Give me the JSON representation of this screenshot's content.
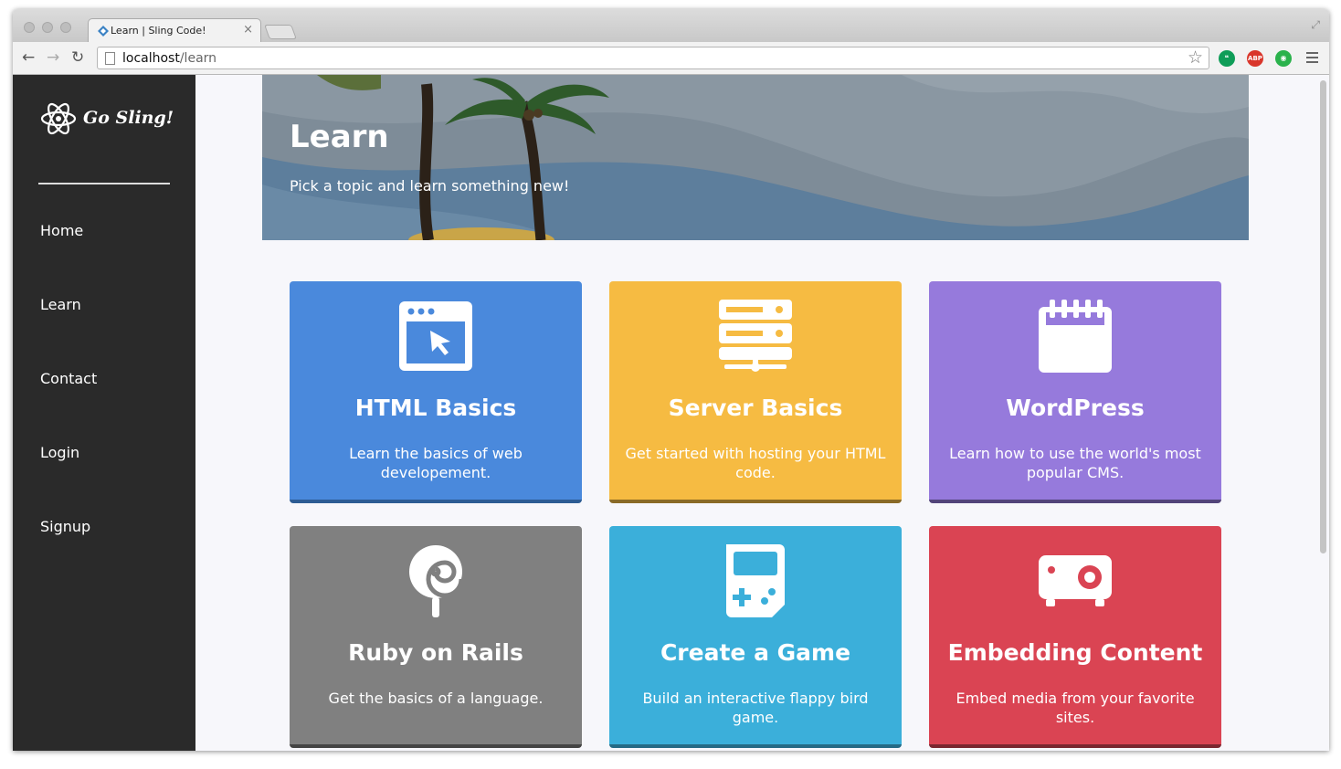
{
  "browser": {
    "tab_title": "Learn | Sling Code!",
    "tab_close": "×",
    "url_host": "localhost",
    "url_path": "/learn",
    "extensions": [
      "hangouts-icon",
      "adblock-plus-icon",
      "feedly-icon"
    ],
    "abp_label": "ABP"
  },
  "sidebar": {
    "brand": "Go Sling!",
    "items": [
      {
        "label": "Home"
      },
      {
        "label": "Learn"
      },
      {
        "label": "Contact"
      },
      {
        "label": "Login"
      },
      {
        "label": "Signup"
      }
    ]
  },
  "hero": {
    "title": "Learn",
    "subtitle": "Pick a topic and learn something new!"
  },
  "cards": [
    {
      "title": "HTML Basics",
      "description": "Learn the basics of web developement.",
      "icon": "browser-window-icon",
      "color": "#4a89dc",
      "border": "#2d5c94"
    },
    {
      "title": "Server Basics",
      "description": "Get started with hosting your HTML code.",
      "icon": "server-icon",
      "color": "#f6bb42",
      "border": "#8a6a27"
    },
    {
      "title": "WordPress",
      "description": "Learn how to use the world's most popular CMS.",
      "icon": "notepad-icon",
      "color": "#967adc",
      "border": "#52447a"
    },
    {
      "title": "Ruby on Rails",
      "description": "Get the basics of a language.",
      "icon": "lollipop-icon",
      "color": "#808080",
      "border": "#444444"
    },
    {
      "title": "Create a Game",
      "description": "Build an interactive flappy bird game.",
      "icon": "game-console-icon",
      "color": "#3bafda",
      "border": "#256a85"
    },
    {
      "title": "Embedding Content",
      "description": "Embed media from your favorite sites.",
      "icon": "projector-icon",
      "color": "#da4453",
      "border": "#7a2730"
    }
  ]
}
